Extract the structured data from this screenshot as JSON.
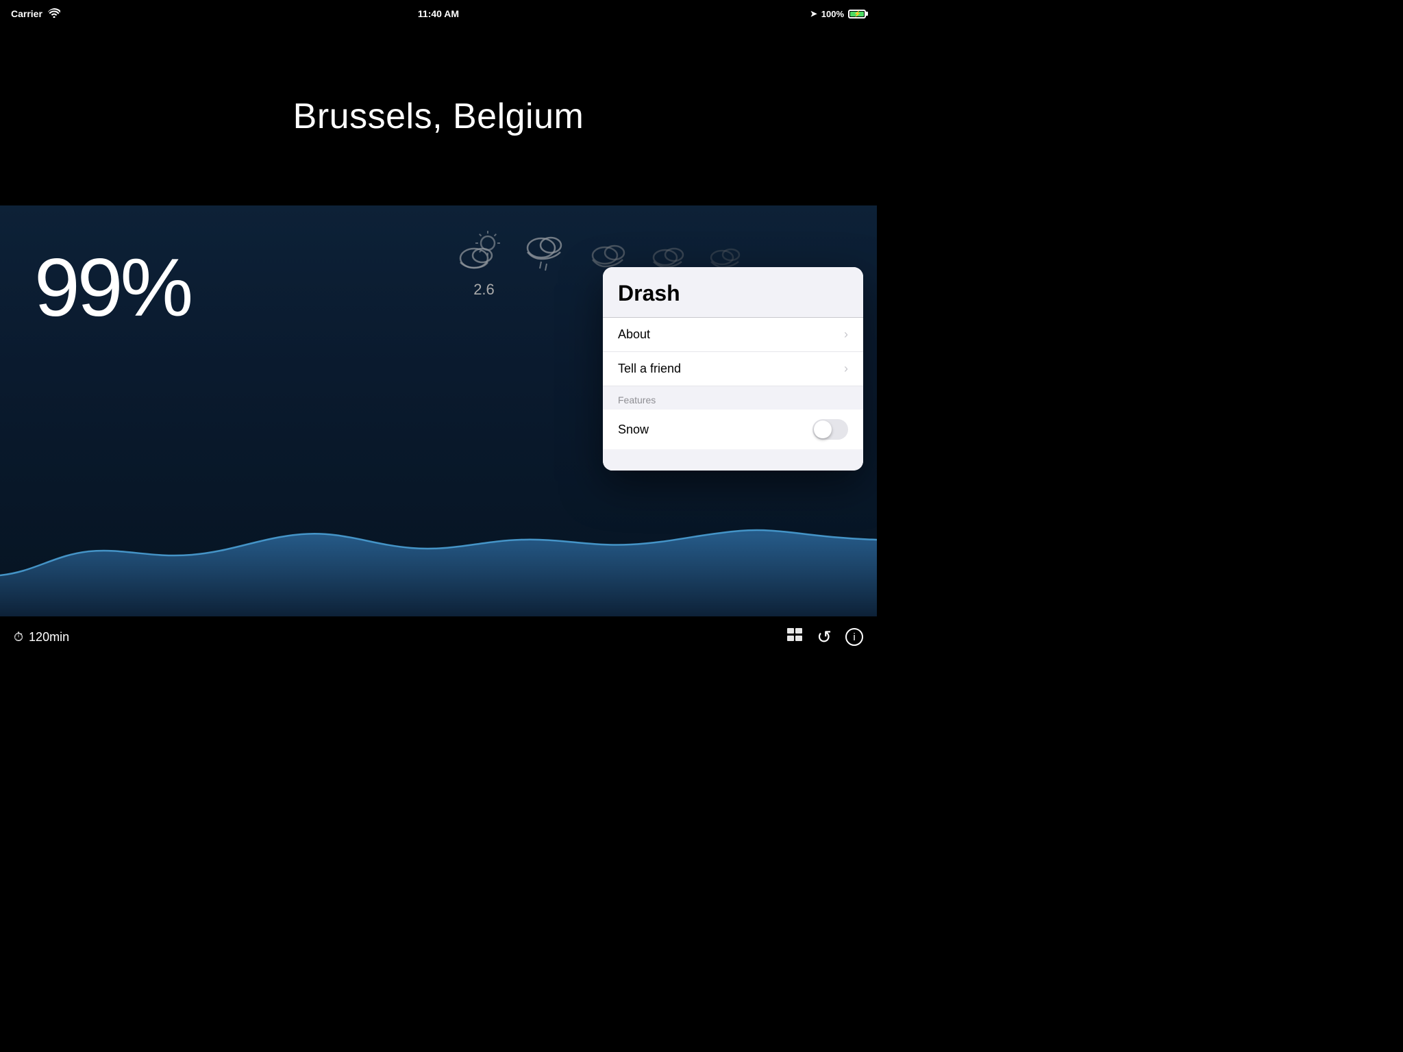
{
  "statusBar": {
    "carrier": "Carrier",
    "time": "11:40 AM",
    "battery_percent": "100%",
    "battery_charging": true
  },
  "weather": {
    "city": "Brussels, Belgium",
    "humidity": "99%",
    "precip_value": "2.6",
    "time_range": "120min"
  },
  "popup": {
    "app_name": "Drash",
    "menu_items": [
      {
        "label": "About",
        "has_chevron": true
      },
      {
        "label": "Tell a friend",
        "has_chevron": true
      }
    ],
    "section_header": "Features",
    "toggle_item": {
      "label": "Snow",
      "enabled": false
    }
  },
  "bottomBar": {
    "time_range": "120min",
    "icons": [
      "gallery-icon",
      "refresh-icon",
      "info-icon"
    ]
  },
  "icons": {
    "gallery": "⊞",
    "refresh": "↺",
    "info": "ⓘ",
    "clock": "⏱",
    "chevron_right": "›"
  }
}
